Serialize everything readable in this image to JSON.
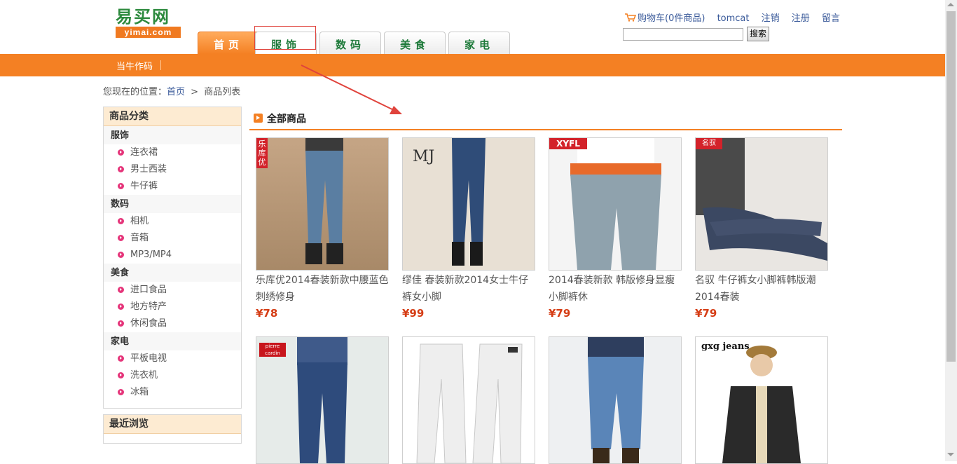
{
  "header": {
    "logo_cn": "易买网",
    "logo_en": "yimai.com",
    "tabs": [
      {
        "label": "首页"
      },
      {
        "label": "服饰"
      },
      {
        "label": "数码"
      },
      {
        "label": "美食"
      },
      {
        "label": "家电"
      }
    ],
    "top_links": {
      "cart": "购物车(0件商品)",
      "user": "tomcat",
      "logout": "注销",
      "register": "注册",
      "message": "留言"
    },
    "search": {
      "button": "搜索",
      "value": ""
    }
  },
  "orange_bar": {
    "item": "当牛作码"
  },
  "breadcrumb": {
    "prefix": "您现在的位置：",
    "home": "首页",
    "sep": ">",
    "current": "商品列表"
  },
  "sidebar": {
    "title": "商品分类",
    "groups": [
      {
        "name": "服饰",
        "items": [
          "连衣裙",
          "男士西装",
          "牛仔裤"
        ]
      },
      {
        "name": "数码",
        "items": [
          "相机",
          "音箱",
          "MP3/MP4"
        ]
      },
      {
        "name": "美食",
        "items": [
          "进口食品",
          "地方特产",
          "休闲食品"
        ]
      },
      {
        "name": "家电",
        "items": [
          "平板电视",
          "洗衣机",
          "冰箱"
        ]
      }
    ],
    "recent_title": "最近浏览"
  },
  "main": {
    "title": "全部商品",
    "products": [
      {
        "name": "乐库优2014春装新款中腰蓝色刺绣修身",
        "price": "¥78",
        "badge": "乐库优"
      },
      {
        "name": "缪佳 春装新款2014女士牛仔裤女小脚",
        "price": "¥99",
        "badge": "MJ"
      },
      {
        "name": "2014春装新款 韩版修身显瘦小脚裤休",
        "price": "¥79",
        "badge": "XYFL"
      },
      {
        "name": "名驭 牛仔裤女小脚裤韩版潮2014春装",
        "price": "¥79",
        "badge": "名驭"
      },
      {
        "name": "",
        "price": "",
        "badge": "pierre cardin"
      },
      {
        "name": "",
        "price": "",
        "badge": ""
      },
      {
        "name": "",
        "price": "",
        "badge": ""
      },
      {
        "name": "",
        "price": "",
        "badge": "gxg jeans"
      }
    ]
  },
  "colors": {
    "accent_orange": "#f48023",
    "brand_green": "#2d8a3e",
    "price_red": "#d53c14",
    "annotation_red": "#e0433c"
  }
}
